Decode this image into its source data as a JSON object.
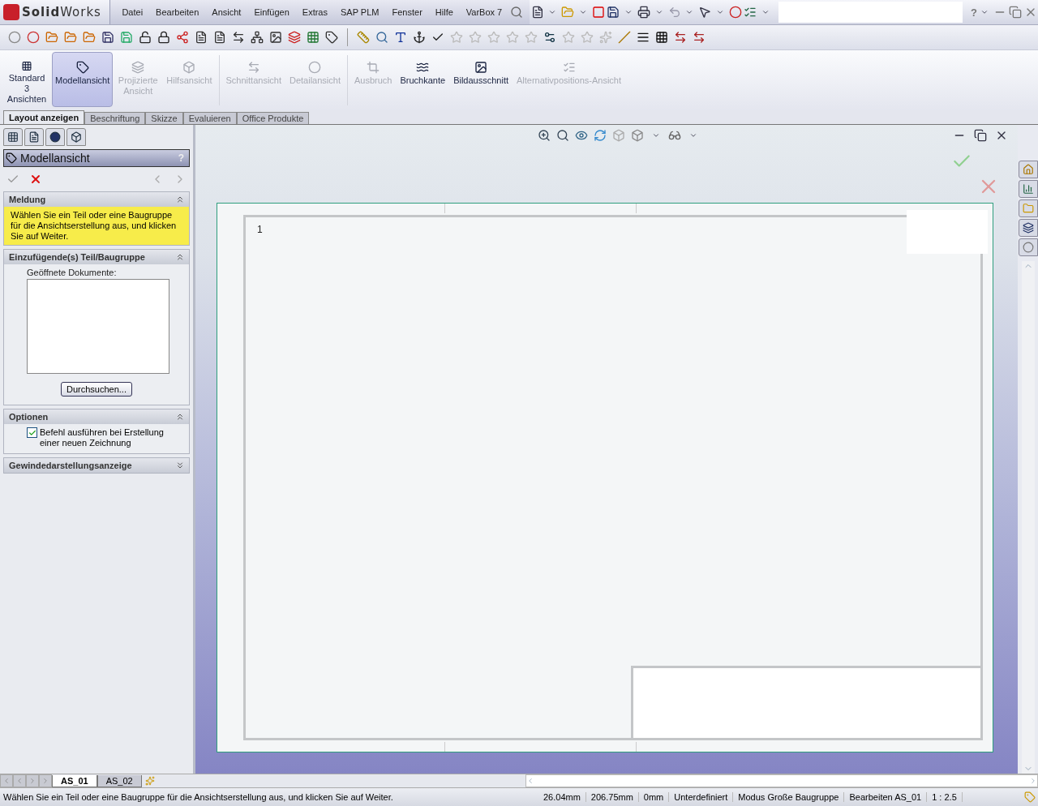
{
  "app": {
    "logo": "**Solid**Works"
  },
  "menu": [
    "Datei",
    "Bearbeiten",
    "Ansicht",
    "Einfügen",
    "Extras",
    "SAP PLM",
    "Fenster",
    "Hilfe",
    "VarBox 7"
  ],
  "help": "?",
  "command_manager": {
    "buttons": [
      {
        "label": "Standard 3 Ansichten",
        "disabled": false,
        "selected": false
      },
      {
        "label": "Modellansicht",
        "disabled": false,
        "selected": true
      },
      {
        "label": "Projizierte Ansicht",
        "disabled": true,
        "selected": false
      },
      {
        "label": "Hilfsansicht",
        "disabled": true,
        "selected": false
      },
      {
        "label": "Schnittansicht",
        "disabled": true,
        "selected": false
      },
      {
        "label": "Detailansicht",
        "disabled": true,
        "selected": false
      },
      {
        "label": "Ausbruch",
        "disabled": true,
        "selected": false
      },
      {
        "label": "Bruchkante",
        "disabled": false,
        "selected": false
      },
      {
        "label": "Bildausschnitt",
        "disabled": false,
        "selected": false
      },
      {
        "label": "Alternativpositions-Ansicht",
        "disabled": true,
        "selected": false
      }
    ]
  },
  "tabs": [
    {
      "label": "Layout anzeigen",
      "selected": true
    },
    {
      "label": "Beschriftung",
      "selected": false
    },
    {
      "label": "Skizze",
      "selected": false
    },
    {
      "label": "Evaluieren",
      "selected": false
    },
    {
      "label": "Office Produkte",
      "selected": false
    }
  ],
  "property_manager": {
    "title": "Modellansicht",
    "help": "?",
    "sections": [
      {
        "kind": "message",
        "title": "Meldung",
        "expanded": true,
        "text": "Wählen Sie ein Teil oder eine Baugruppe für die Ansichtserstellung aus, und klicken Sie auf Weiter."
      },
      {
        "kind": "documents",
        "title": "Einzufügende(s) Teil/Baugruppe",
        "expanded": true,
        "label": "Geöffnete Dokumente:",
        "button": "Durchsuchen..."
      },
      {
        "kind": "options",
        "title": "Optionen",
        "expanded": true,
        "options": [
          {
            "label": "Befehl ausführen bei Erstellung einer neuen Zeichnung",
            "checked": true
          }
        ]
      },
      {
        "kind": "group",
        "title": "Gewindedarstellungsanzeige",
        "expanded": false
      }
    ]
  },
  "drawing": {
    "sheet_number": "1"
  },
  "sheet_tabs": [
    {
      "label": "AS_01",
      "selected": true
    },
    {
      "label": "AS_02",
      "selected": false
    }
  ],
  "status_bar": {
    "message": "Wählen Sie ein Teil oder eine Baugruppe für die Ansichtserstellung aus, und klicken Sie auf Weiter.",
    "fields": [
      "26.04mm",
      "206.75mm",
      "0mm",
      "Unterdefiniert",
      "Modus Große Baugruppe",
      "Bearbeiten AS_01",
      "1 : 2.5"
    ]
  }
}
